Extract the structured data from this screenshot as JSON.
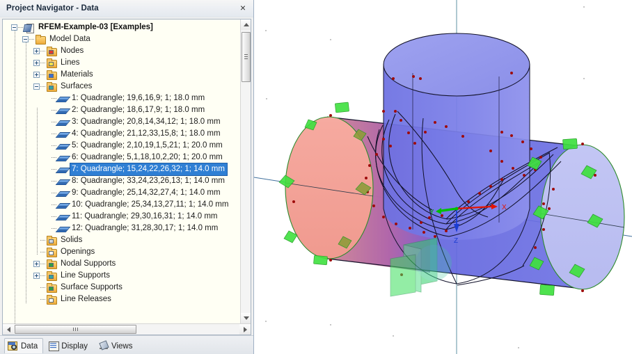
{
  "window": {
    "title": "Project Navigator - Data",
    "close_label": "×"
  },
  "tree": {
    "root": {
      "label": "RFEM-Example-03 [Examples]",
      "icon": "project-document-icon",
      "expanded": true
    },
    "model_data": {
      "label": "Model Data",
      "icon": "folder-icon",
      "expanded": true
    },
    "nodes": {
      "label": "Nodes",
      "icon": "folder-nodes-icon",
      "expanded": false
    },
    "lines": {
      "label": "Lines",
      "icon": "folder-lines-icon",
      "expanded": false
    },
    "materials": {
      "label": "Materials",
      "icon": "folder-materials-icon",
      "expanded": false
    },
    "surfaces_folder": {
      "label": "Surfaces",
      "icon": "folder-surfaces-icon",
      "expanded": true
    },
    "surfaces": [
      {
        "label": "1: Quadrangle; 19,6,16,9; 1; 18.0 mm",
        "selected": false
      },
      {
        "label": "2: Quadrangle; 18,6,17,9; 1; 18.0 mm",
        "selected": false
      },
      {
        "label": "3: Quadrangle; 20,8,14,34,12; 1; 18.0 mm",
        "selected": false
      },
      {
        "label": "4: Quadrangle; 21,12,33,15,8; 1; 18.0 mm",
        "selected": false
      },
      {
        "label": "5: Quadrangle; 2,10,19,1,5,21; 1; 20.0 mm",
        "selected": false
      },
      {
        "label": "6: Quadrangle; 5,1,18,10,2,20; 1; 20.0 mm",
        "selected": false
      },
      {
        "label": "7: Quadrangle; 15,24,22,26,32; 1; 14.0 mm",
        "selected": true
      },
      {
        "label": "8: Quadrangle; 33,24,23,26,13; 1; 14.0 mm",
        "selected": false
      },
      {
        "label": "9: Quadrangle; 25,14,32,27,4; 1; 14.0 mm",
        "selected": false
      },
      {
        "label": "10: Quadrangle; 25,34,13,27,11; 1; 14.0 mm",
        "selected": false
      },
      {
        "label": "11: Quadrangle; 29,30,16,31; 1; 14.0 mm",
        "selected": false
      },
      {
        "label": "12: Quadrangle; 31,28,30,17; 1; 14.0 mm",
        "selected": false
      }
    ],
    "after_surfaces": [
      {
        "label": "Solids",
        "icon": "folder-solids-icon",
        "expander": "none"
      },
      {
        "label": "Openings",
        "icon": "folder-openings-icon",
        "expander": "none"
      },
      {
        "label": "Nodal Supports",
        "icon": "folder-nodal-supports-icon",
        "expander": "plus"
      },
      {
        "label": "Line Supports",
        "icon": "folder-line-supports-icon",
        "expander": "plus"
      },
      {
        "label": "Surface Supports",
        "icon": "folder-surface-supports-icon",
        "expander": "none"
      },
      {
        "label": "Line Releases",
        "icon": "folder-line-releases-icon",
        "expander": "none"
      }
    ]
  },
  "tabs": [
    {
      "label": "Data",
      "icon": "data-icon",
      "active": true
    },
    {
      "label": "Display",
      "icon": "display-icon",
      "active": false
    },
    {
      "label": "Views",
      "icon": "views-icon",
      "active": false
    }
  ],
  "viewport": {
    "axes": {
      "x_label": "X",
      "y_label": "Y",
      "z_label": "Z"
    },
    "colors": {
      "axis_x": "#e51400",
      "axis_y": "#00c000",
      "axis_z": "#1a3cd2",
      "pipe_blue": "#6a6ee0",
      "pipe_blue_light": "#a3a7ee",
      "cap_red": "#f2a096",
      "cap_lavender": "#bdc0f0",
      "support_green": "#2ce02c",
      "node_red": "#b00000",
      "edge_dark": "#101020",
      "grid_axis": "#4f8a9a",
      "background": "#ffffff"
    }
  }
}
